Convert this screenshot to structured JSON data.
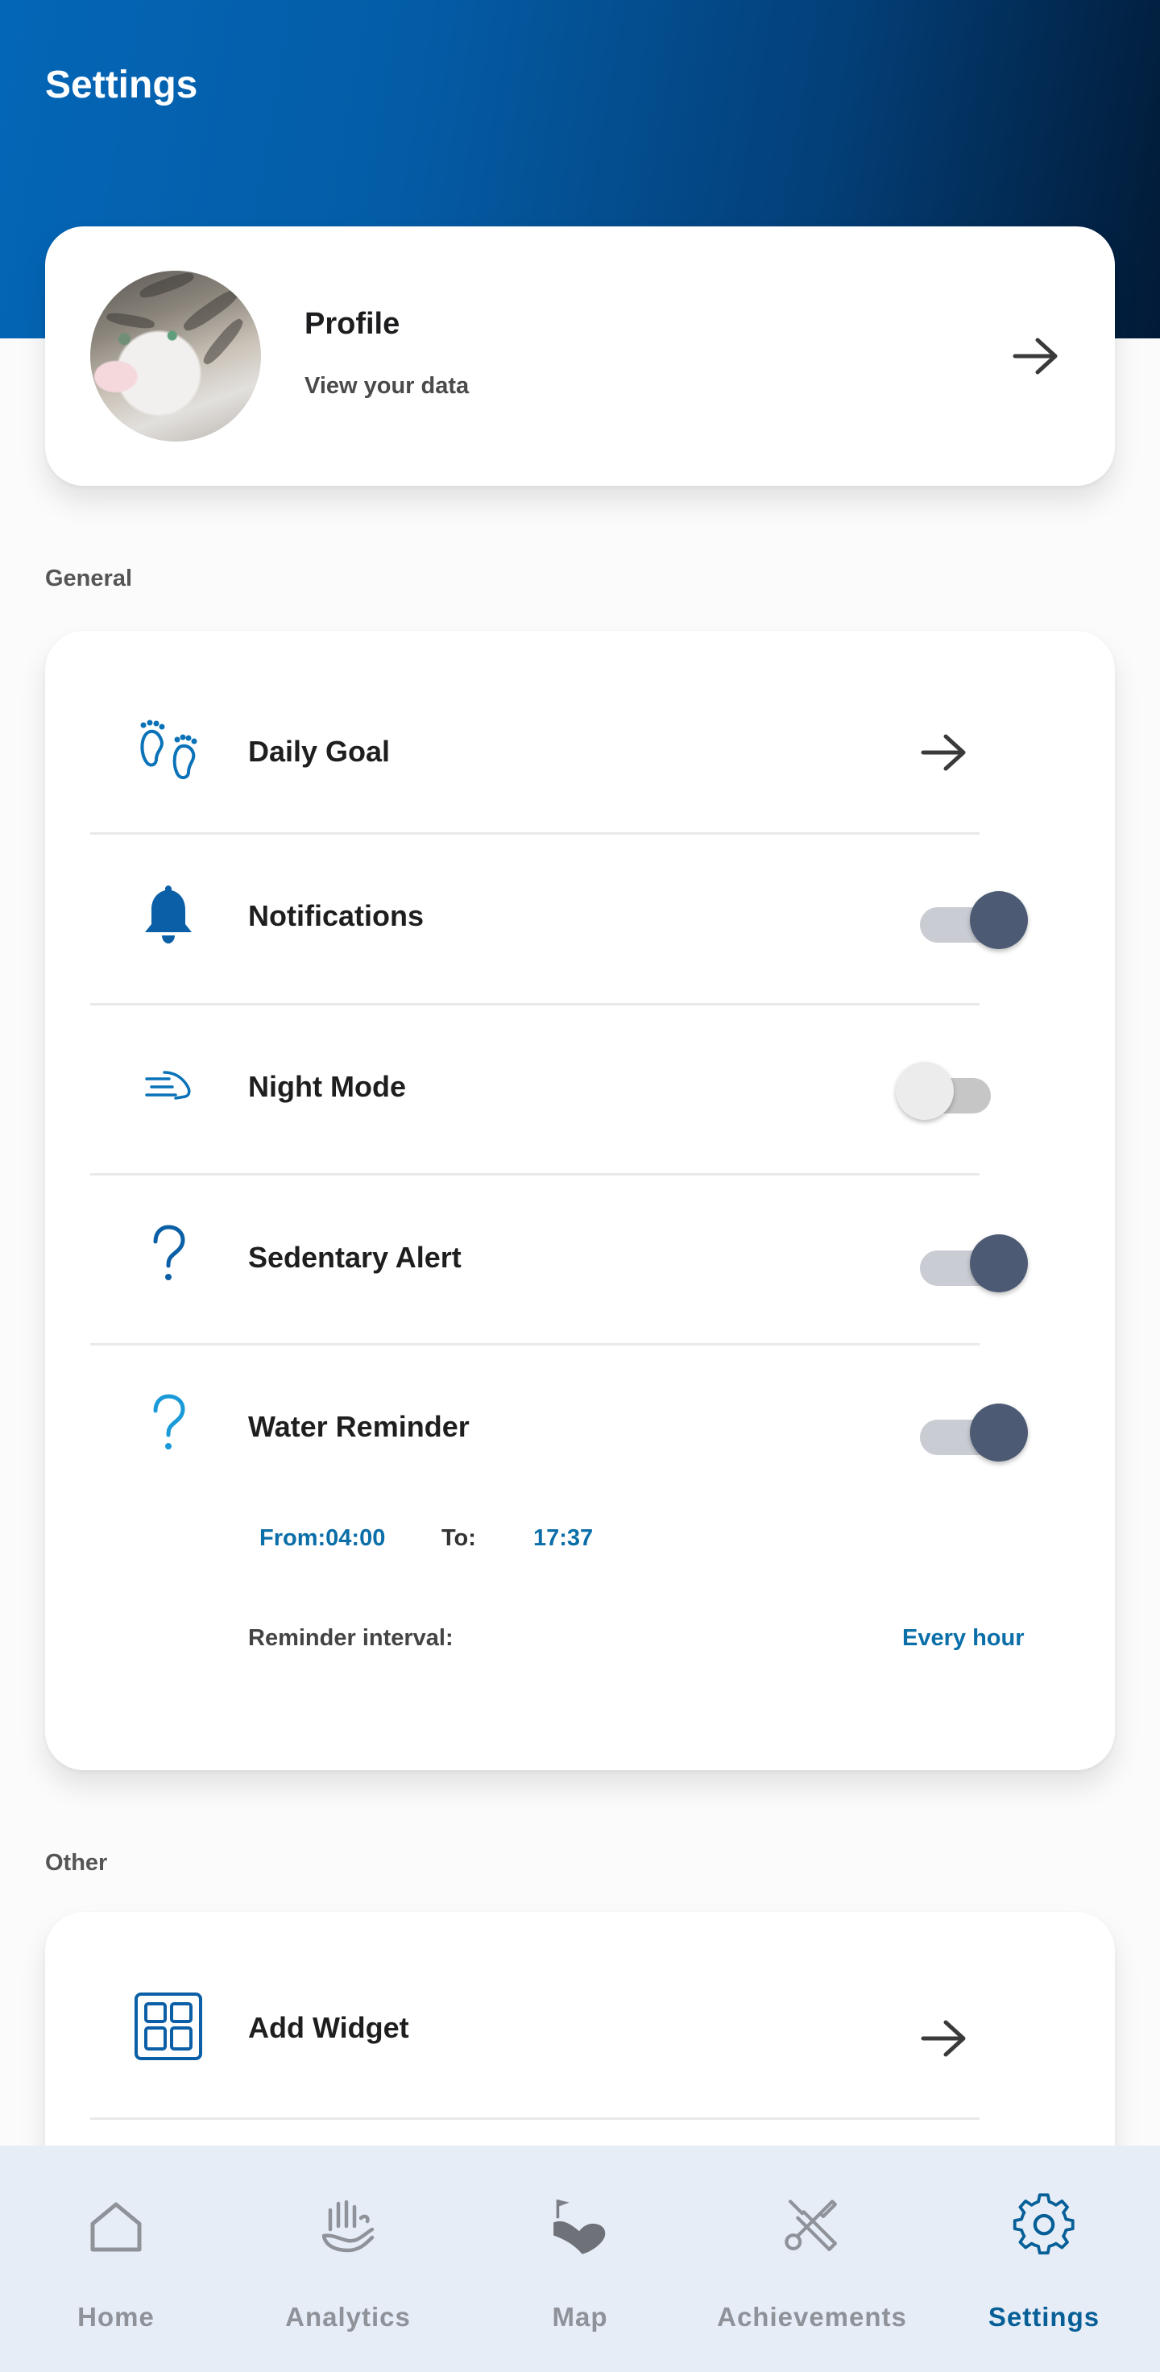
{
  "header": {
    "title": "Settings"
  },
  "profile": {
    "title": "Profile",
    "subtitle": "View your data"
  },
  "sections": {
    "general": "General",
    "other": "Other"
  },
  "general": {
    "daily_goal": "Daily Goal",
    "notifications": {
      "label": "Notifications",
      "enabled": true
    },
    "night_mode": {
      "label": "Night Mode",
      "enabled": false
    },
    "sedentary_alert": {
      "label": "Sedentary Alert",
      "enabled": true
    },
    "water_reminder": {
      "label": "Water Reminder",
      "enabled": true,
      "from": "From:04:00",
      "to_label": "To:",
      "to": "17:37",
      "interval_label": "Reminder interval:",
      "interval_value": "Every hour"
    }
  },
  "other": {
    "add_widget": "Add Widget"
  },
  "nav": {
    "items": [
      {
        "label": "Home",
        "icon": "home-icon"
      },
      {
        "label": "Analytics",
        "icon": "hand-icon"
      },
      {
        "label": "Map",
        "icon": "map-icon"
      },
      {
        "label": "Achievements",
        "icon": "tools-icon"
      },
      {
        "label": "Settings",
        "icon": "gear-icon",
        "active": true
      }
    ]
  },
  "colors": {
    "accent": "#0a6ea8",
    "header_start": "#0466b7",
    "header_end": "#021a36",
    "toggle_on": "#4d5a74"
  }
}
